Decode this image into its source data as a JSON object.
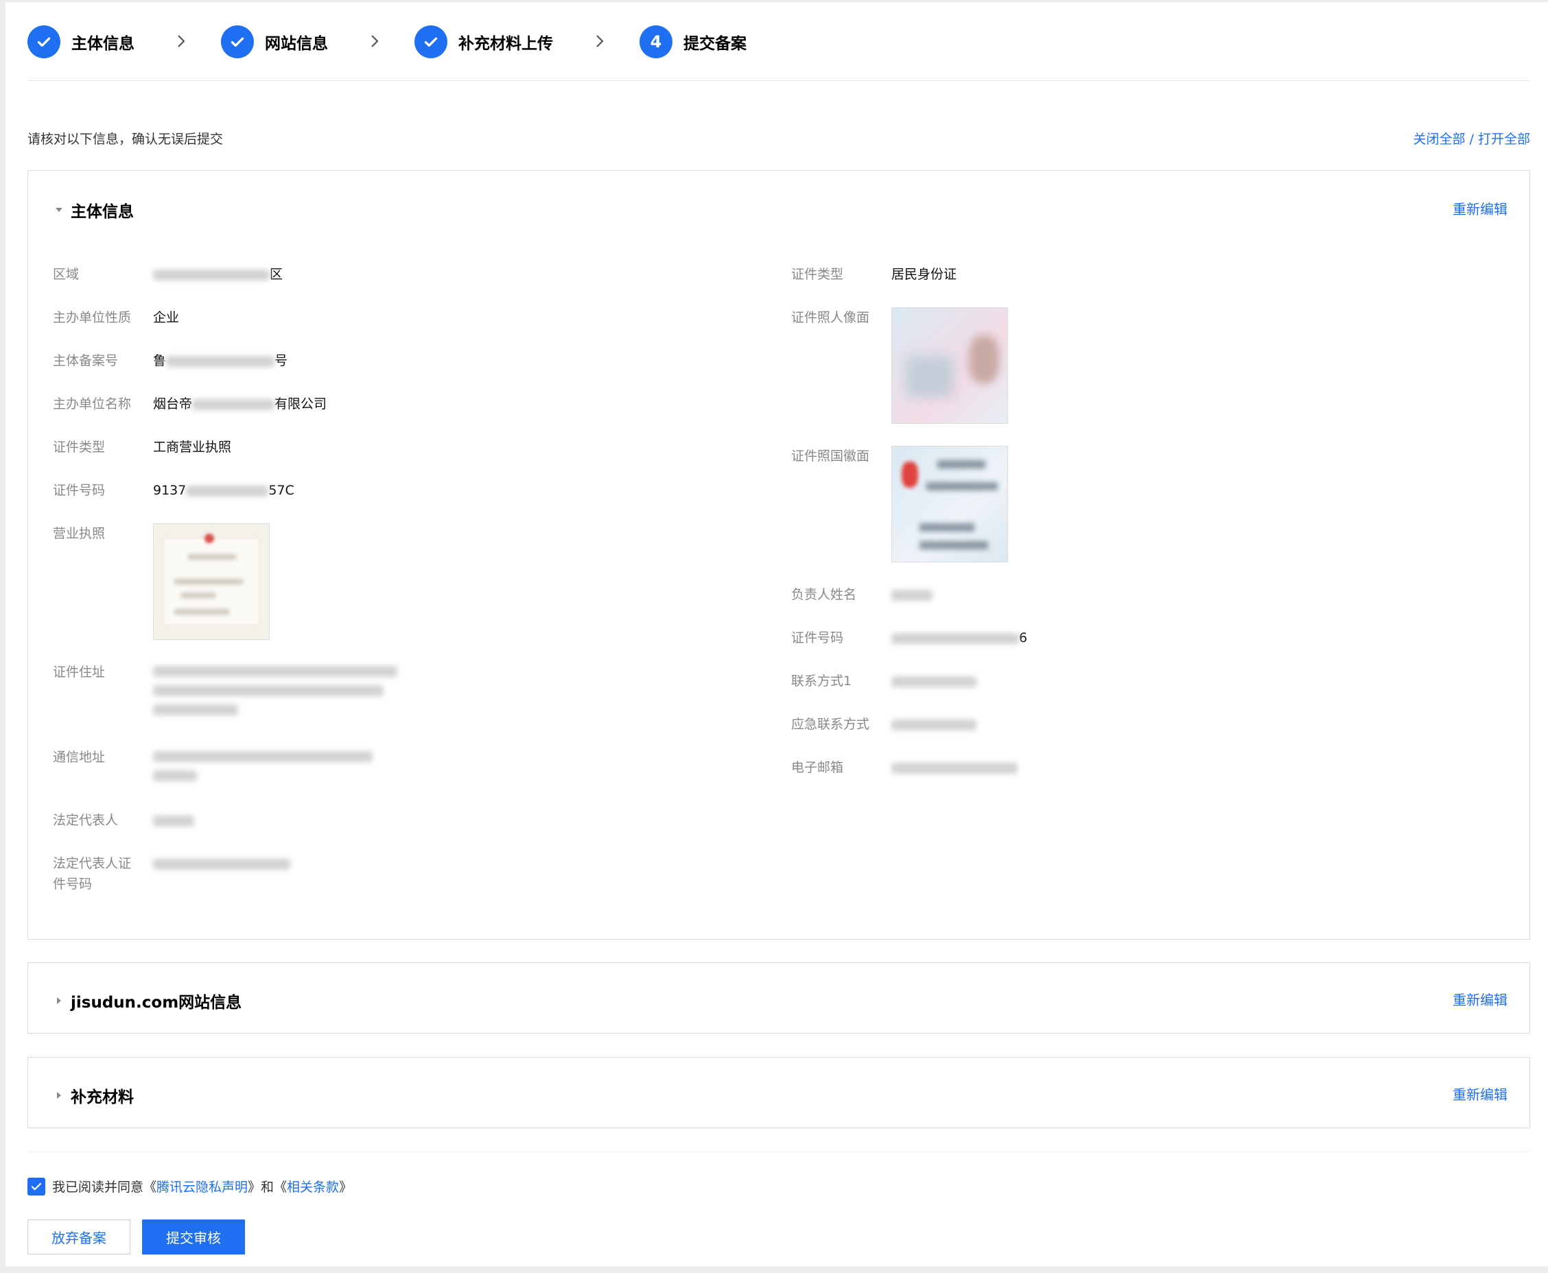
{
  "stepper": {
    "steps": [
      {
        "label": "主体信息",
        "state": "done"
      },
      {
        "label": "网站信息",
        "state": "done"
      },
      {
        "label": "补充材料上传",
        "state": "done"
      },
      {
        "label": "提交备案",
        "state": "current",
        "number": "4"
      }
    ]
  },
  "intro": {
    "text": "请核对以下信息，确认无误后提交",
    "close_all": "关闭全部",
    "separator": " / ",
    "open_all": "打开全部"
  },
  "subject_panel": {
    "title": "主体信息",
    "edit_label": "重新编辑",
    "left": {
      "region_label": "区域",
      "region_suffix": "区",
      "nature_label": "主办单位性质",
      "nature_value": "企业",
      "record_label": "主体备案号",
      "record_prefix": "鲁",
      "record_suffix": "号",
      "org_name_label": "主办单位名称",
      "org_name_prefix": "烟台帝",
      "org_name_suffix": "有限公司",
      "cert_type_label": "证件类型",
      "cert_type_value": "工商营业执照",
      "cert_no_label": "证件号码",
      "cert_no_prefix": "9137",
      "cert_no_suffix": "57C",
      "license_label": "营业执照",
      "cert_addr_label": "证件住址",
      "mail_addr_label": "通信地址",
      "legal_rep_label": "法定代表人",
      "legal_rep_id_label_1": "法定代表人证",
      "legal_rep_id_label_2": "件号码"
    },
    "right": {
      "id_type_label": "证件类型",
      "id_type_value": "居民身份证",
      "id_front_label": "证件照人像面",
      "id_back_label": "证件照国徽面",
      "owner_name_label": "负责人姓名",
      "id_no_label": "证件号码",
      "id_no_suffix": "6",
      "contact1_label": "联系方式1",
      "emergency_label": "应急联系方式",
      "email_label": "电子邮箱"
    }
  },
  "website_panel": {
    "title": "jisudun.com网站信息",
    "edit_label": "重新编辑"
  },
  "materials_panel": {
    "title": "补充材料",
    "edit_label": "重新编辑"
  },
  "agreement": {
    "prefix": "我已阅读并同意《",
    "privacy_link": "腾讯云隐私声明",
    "middle": "》和《",
    "terms_link": "相关条款",
    "suffix": "》",
    "checked": true
  },
  "actions": {
    "abandon_label": "放弃备案",
    "submit_label": "提交审核"
  },
  "colors": {
    "accent": "#1e6ff1",
    "label_gray": "#888888",
    "border": "#dcdcdc"
  }
}
